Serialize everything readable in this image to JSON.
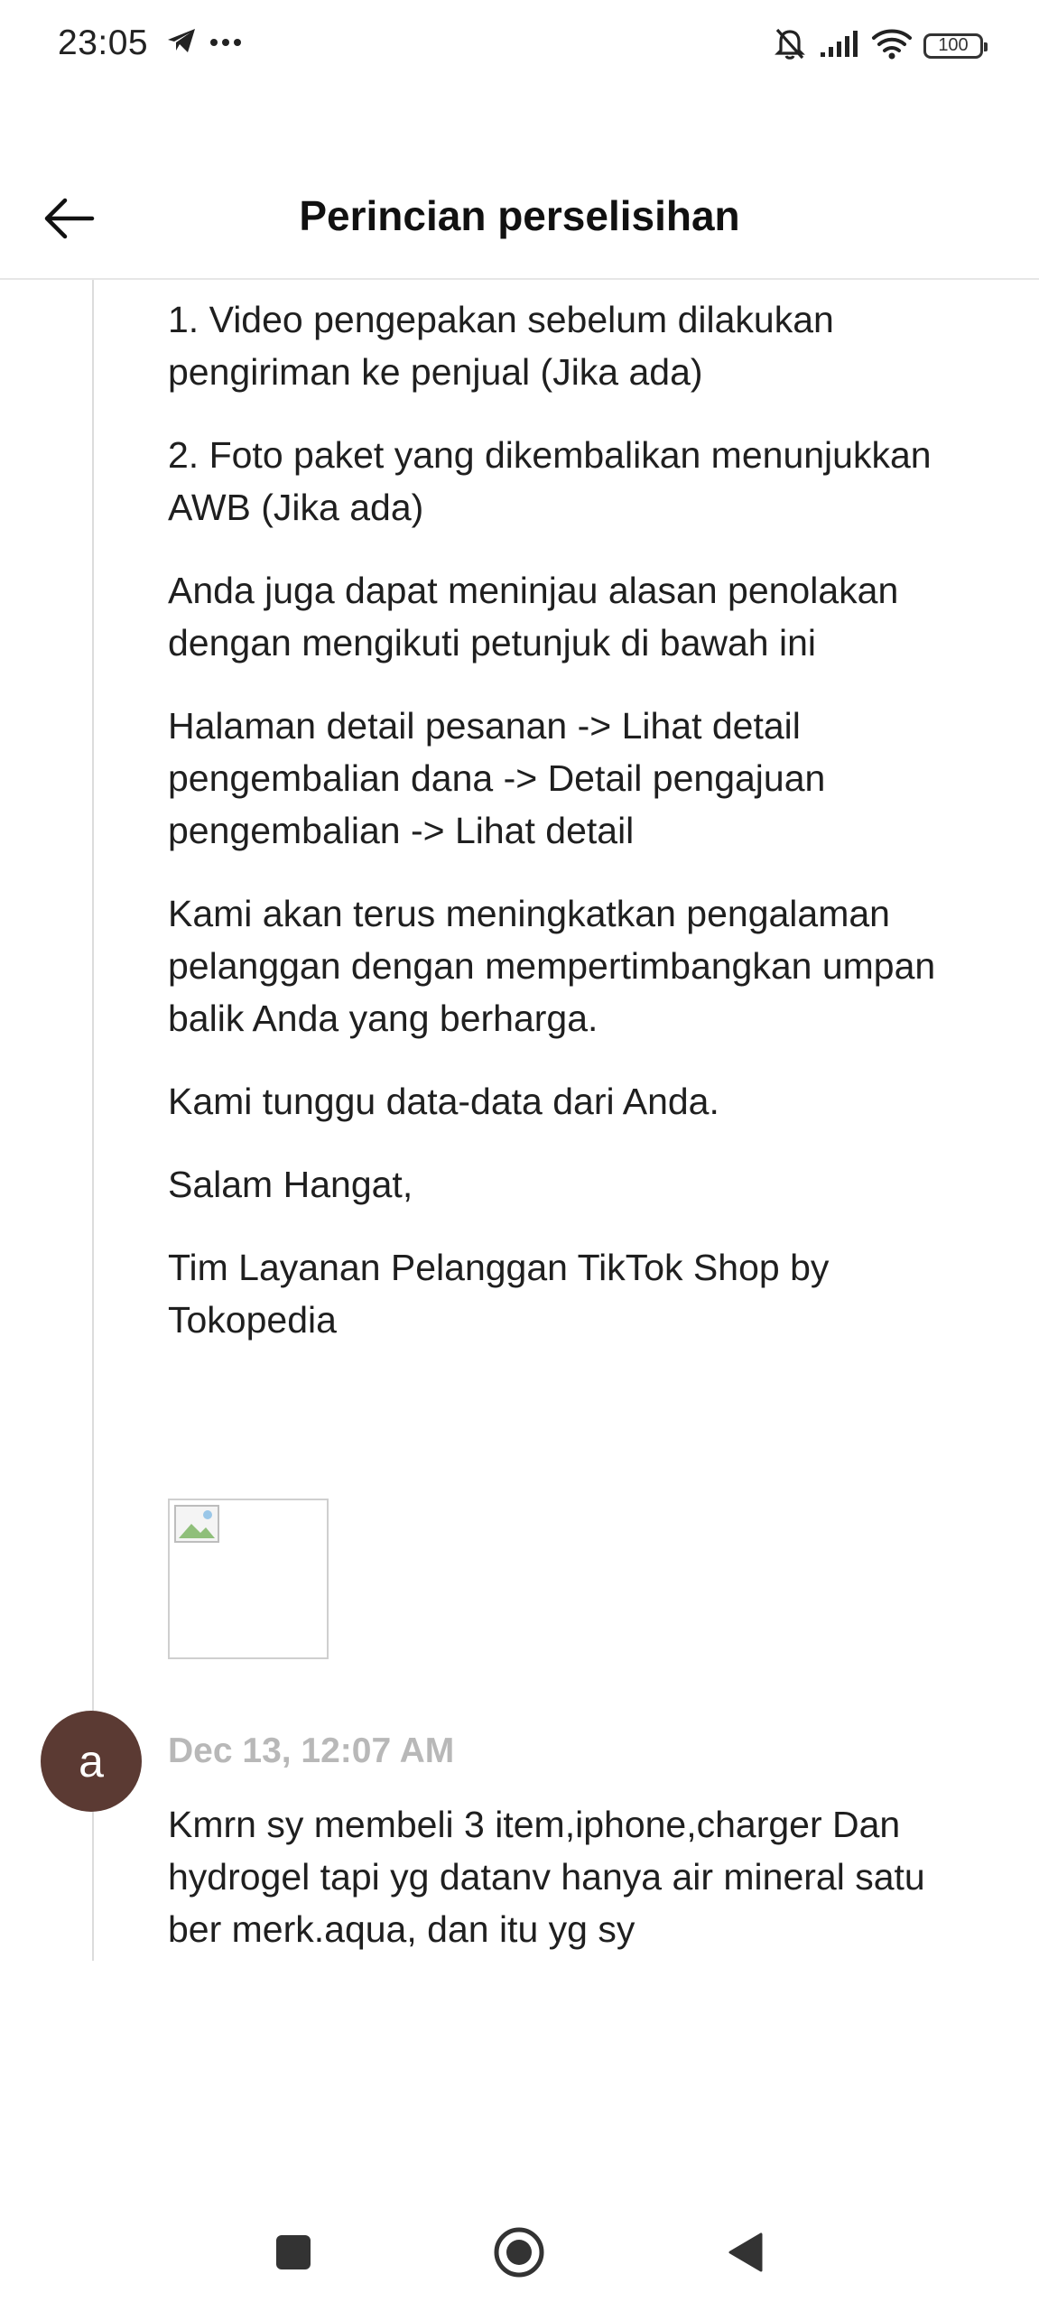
{
  "status_bar": {
    "time": "23:05",
    "left_icons": [
      "telegram-icon",
      "more-dots-icon"
    ],
    "right_icons": [
      "bell-off-icon",
      "signal-icon",
      "wifi-icon",
      "battery-icon"
    ],
    "battery_level": "100"
  },
  "header": {
    "title": "Perincian perselisihan",
    "back_icon": "arrow-left-icon"
  },
  "message": {
    "paragraphs": [
      "1. Video pengepakan sebelum dilakukan pengiriman ke penjual (Jika ada)",
      "2. Foto paket yang dikembalikan menunjukkan AWB (Jika ada)",
      "Anda juga dapat meninjau alasan penolakan dengan mengikuti petunjuk di bawah ini",
      "Halaman detail pesanan -> Lihat detail pengembalian dana -> Detail pengajuan pengembalian -> Lihat detail",
      "Kami akan terus meningkatkan pengalaman pelanggan dengan mempertimbangkan umpan balik Anda yang berharga.",
      "Kami tunggu data-data dari Anda.",
      "Salam Hangat,",
      "Tim Layanan Pelanggan TikTok Shop by Tokopedia"
    ]
  },
  "user_entry": {
    "avatar_letter": "a",
    "avatar_color": "#5b3a33",
    "timestamp": "Dec 13, 12:07 AM",
    "text": "Kmrn sy membeli 3 item,iphone,charger Dan hydrogel tapi yg datanv hanya air mineral satu ber merk.aqua, dan itu yg sy"
  },
  "nav_bar": {
    "icons": [
      "recents-square-icon",
      "home-circle-icon",
      "back-triangle-icon"
    ]
  }
}
